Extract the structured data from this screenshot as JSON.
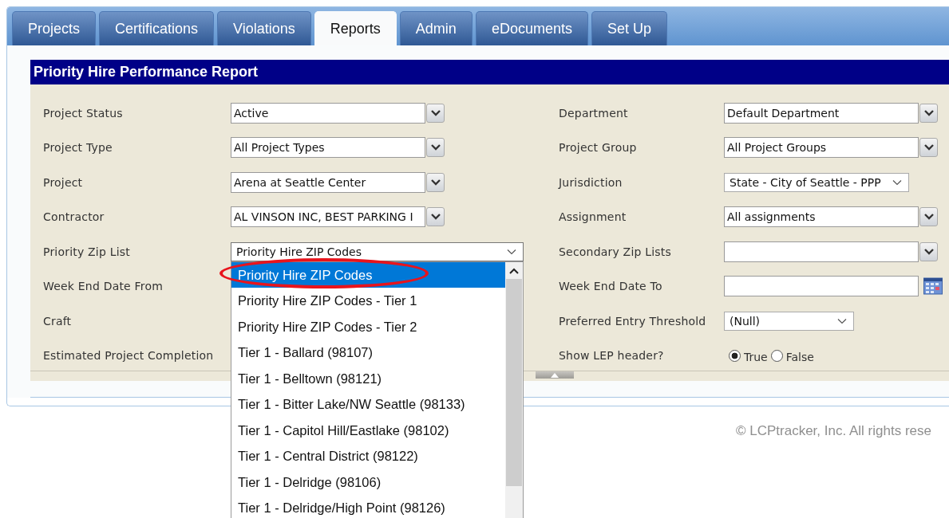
{
  "tabs": [
    {
      "label": "Projects",
      "selected": false
    },
    {
      "label": "Certifications",
      "selected": false
    },
    {
      "label": "Violations",
      "selected": false
    },
    {
      "label": "Reports",
      "selected": true
    },
    {
      "label": "Admin",
      "selected": false
    },
    {
      "label": "eDocuments",
      "selected": false
    },
    {
      "label": "Set Up",
      "selected": false
    }
  ],
  "report": {
    "title": "Priority Hire Performance Report",
    "left_fields": [
      {
        "label": "Project Status",
        "kind": "select",
        "value": "Active"
      },
      {
        "label": "Project Type",
        "kind": "select",
        "value": "All Project Types"
      },
      {
        "label": "Project",
        "kind": "select",
        "value": "Arena at Seattle Center"
      },
      {
        "label": "Contractor",
        "kind": "select",
        "value": "AL VINSON INC, BEST PARKING I"
      },
      {
        "label": "Priority Zip List",
        "kind": "native",
        "value": "Priority Hire ZIP Codes",
        "expanded": true,
        "options": [
          {
            "label": "Priority Hire ZIP Codes",
            "selected": true,
            "circled": true
          },
          {
            "label": "Priority Hire ZIP Codes - Tier 1",
            "selected": false,
            "circled": false
          },
          {
            "label": "Priority Hire ZIP Codes - Tier 2",
            "selected": false,
            "circled": false
          },
          {
            "label": "Tier 1 - Ballard (98107)",
            "selected": false,
            "circled": false
          },
          {
            "label": "Tier 1 - Belltown (98121)",
            "selected": false,
            "circled": false
          },
          {
            "label": "Tier 1 - Bitter Lake/NW Seattle (98133)",
            "selected": false,
            "circled": false
          },
          {
            "label": "Tier 1 - Capitol Hill/Eastlake (98102)",
            "selected": false,
            "circled": false
          },
          {
            "label": "Tier 1 - Central District (98122)",
            "selected": false,
            "circled": false
          },
          {
            "label": "Tier 1 - Delridge (98106)",
            "selected": false,
            "circled": false
          },
          {
            "label": "Tier 1 - Delridge/High Point (98126)",
            "selected": false,
            "circled": false
          }
        ]
      },
      {
        "label": "Week End Date From",
        "kind": "covered"
      },
      {
        "label": "Craft",
        "kind": "covered"
      },
      {
        "label": "Estimated Project Completion",
        "kind": "covered"
      }
    ],
    "right_fields": [
      {
        "label": "Department",
        "kind": "select",
        "value": "Default Department"
      },
      {
        "label": "Project Group",
        "kind": "select",
        "value": "All Project Groups"
      },
      {
        "label": "Jurisdiction",
        "kind": "native",
        "value": "State - City of Seattle - PPP",
        "expanded": false
      },
      {
        "label": "Assignment",
        "kind": "select",
        "value": "All assignments"
      },
      {
        "label": "Secondary Zip Lists",
        "kind": "select"
      },
      {
        "label": "Week End Date To",
        "kind": "date"
      },
      {
        "label": "Preferred Entry Threshold",
        "kind": "native",
        "value": "(Null)",
        "expanded": false
      },
      {
        "label": "Show LEP header?",
        "kind": "radio",
        "options": [
          {
            "label": "True",
            "selected": true
          },
          {
            "label": "False",
            "selected": false
          }
        ]
      }
    ]
  },
  "footer": {
    "copyright": "© LCPtracker, Inc. All rights rese"
  }
}
